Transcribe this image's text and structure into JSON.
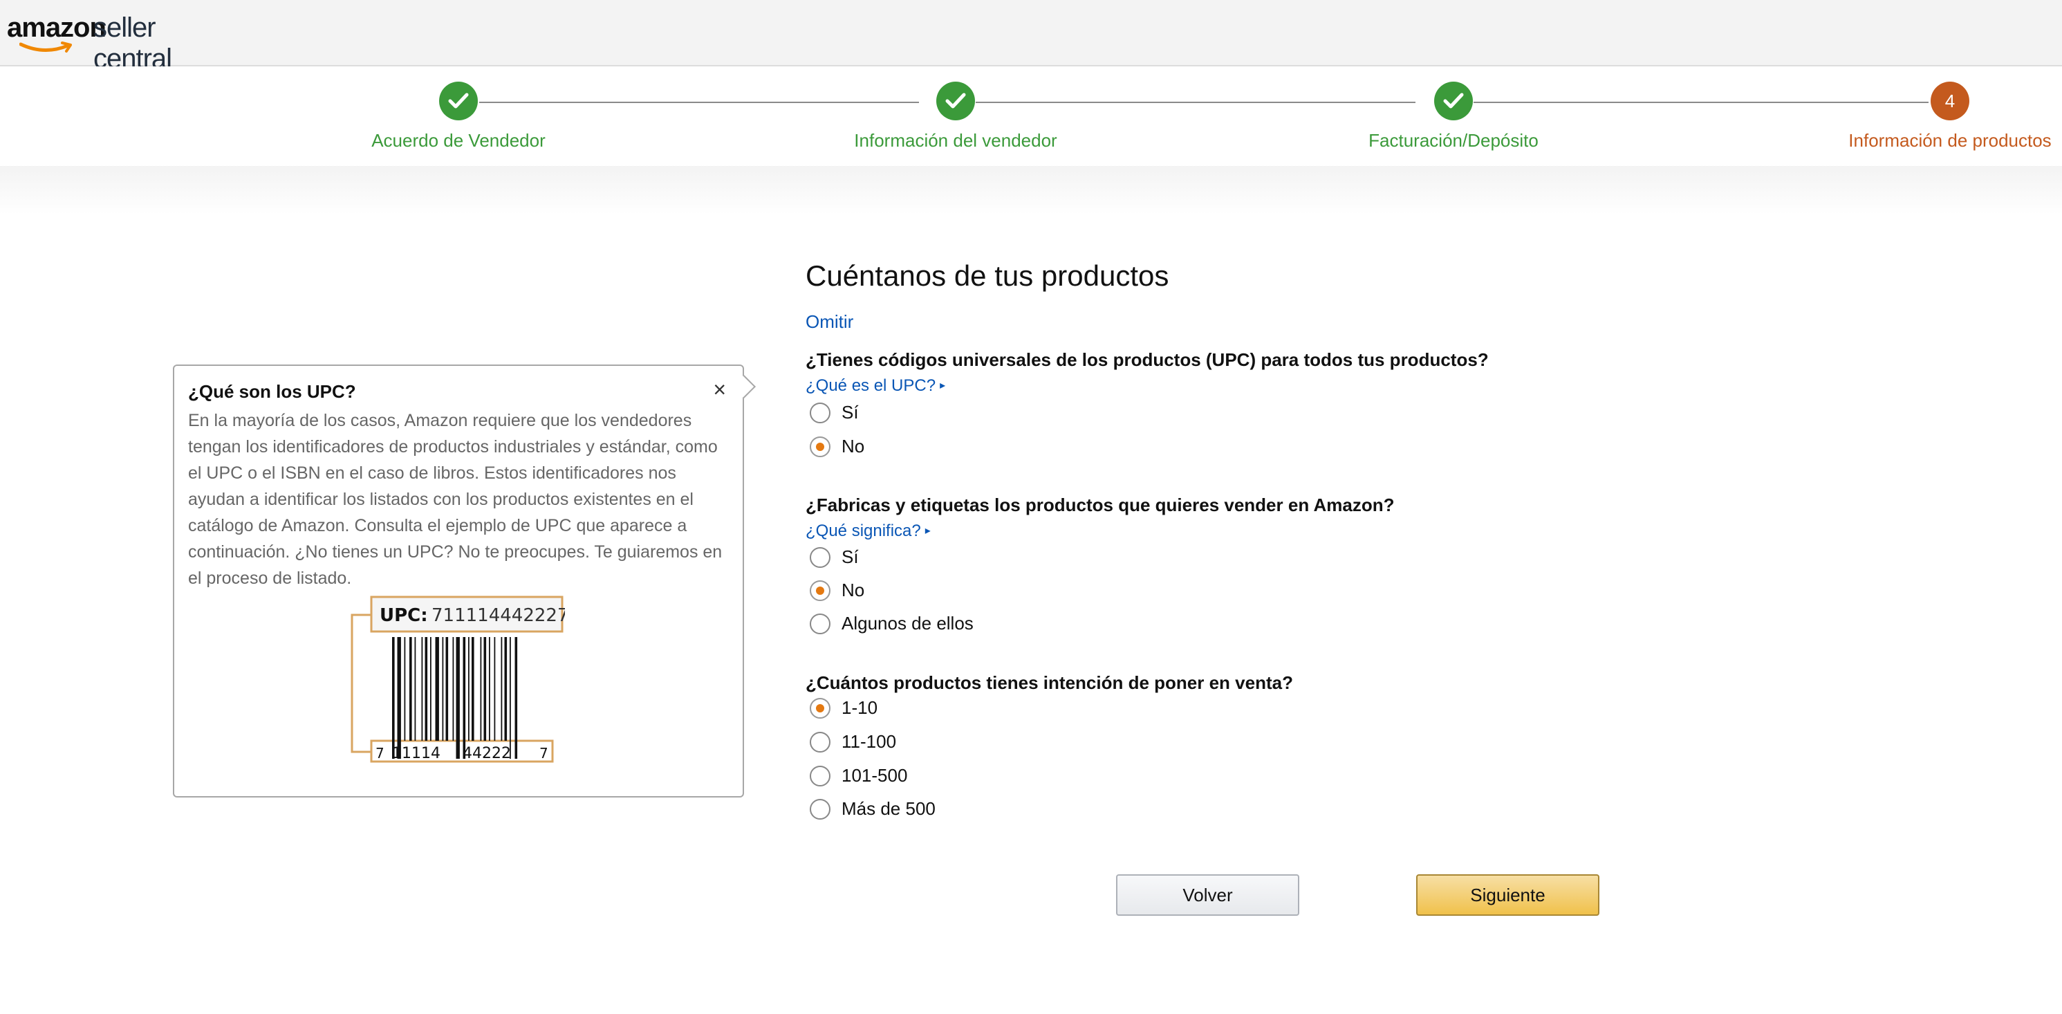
{
  "header": {
    "logo_amazon": "amazon",
    "logo_seller": "seller central"
  },
  "stepper": {
    "steps": [
      {
        "label": "Acuerdo de Vendedor",
        "status": "completed",
        "number": ""
      },
      {
        "label": "Información del vendedor",
        "status": "completed",
        "number": ""
      },
      {
        "label": "Facturación/Depósito",
        "status": "completed",
        "number": ""
      },
      {
        "label": "Información de productos",
        "status": "current",
        "number": "4"
      }
    ],
    "colors": {
      "completed": "#3b9a3a",
      "current": "#c45a1e"
    }
  },
  "upc_panel": {
    "title": "¿Qué son los UPC?",
    "close_icon": "×",
    "body": "En la mayoría de los casos, Amazon requiere que los vendedores tengan los identificadores de productos industriales y estándar, como el UPC o el ISBN en el caso de libros. Estos identificadores nos ayudan a identificar los listados con los productos existentes en el catálogo de Amazon. Consulta el ejemplo de UPC que aparece a continuación. ¿No tienes un UPC? No te preocupes. Te guiaremos en el proceso de listado.",
    "example": {
      "upc_label": "UPC:",
      "upc_value": "711114442227",
      "digit_left": "7",
      "digits_group1": "11114",
      "digits_group2": "44222",
      "digit_right": "7"
    }
  },
  "form": {
    "title": "Cuéntanos de tus productos",
    "skip_link": "Omitir",
    "questions": [
      {
        "question": "¿Tienes códigos universales de los productos (UPC) para todos tus productos?",
        "help_link": "¿Qué es el UPC?",
        "options": [
          "Sí",
          "No"
        ],
        "selected": "No"
      },
      {
        "question": "¿Fabricas y etiquetas los productos que quieres vender en Amazon?",
        "help_link": "¿Qué significa?",
        "options": [
          "Sí",
          "No",
          "Algunos de ellos"
        ],
        "selected": "No"
      },
      {
        "question": "¿Cuántos productos tienes intención de poner en venta?",
        "help_link": "",
        "options": [
          "1-10",
          "11-100",
          "101-500",
          "Más de 500"
        ],
        "selected": "1-10"
      }
    ]
  },
  "buttons": {
    "back_label": "Volver",
    "next_label": "Siguiente"
  }
}
